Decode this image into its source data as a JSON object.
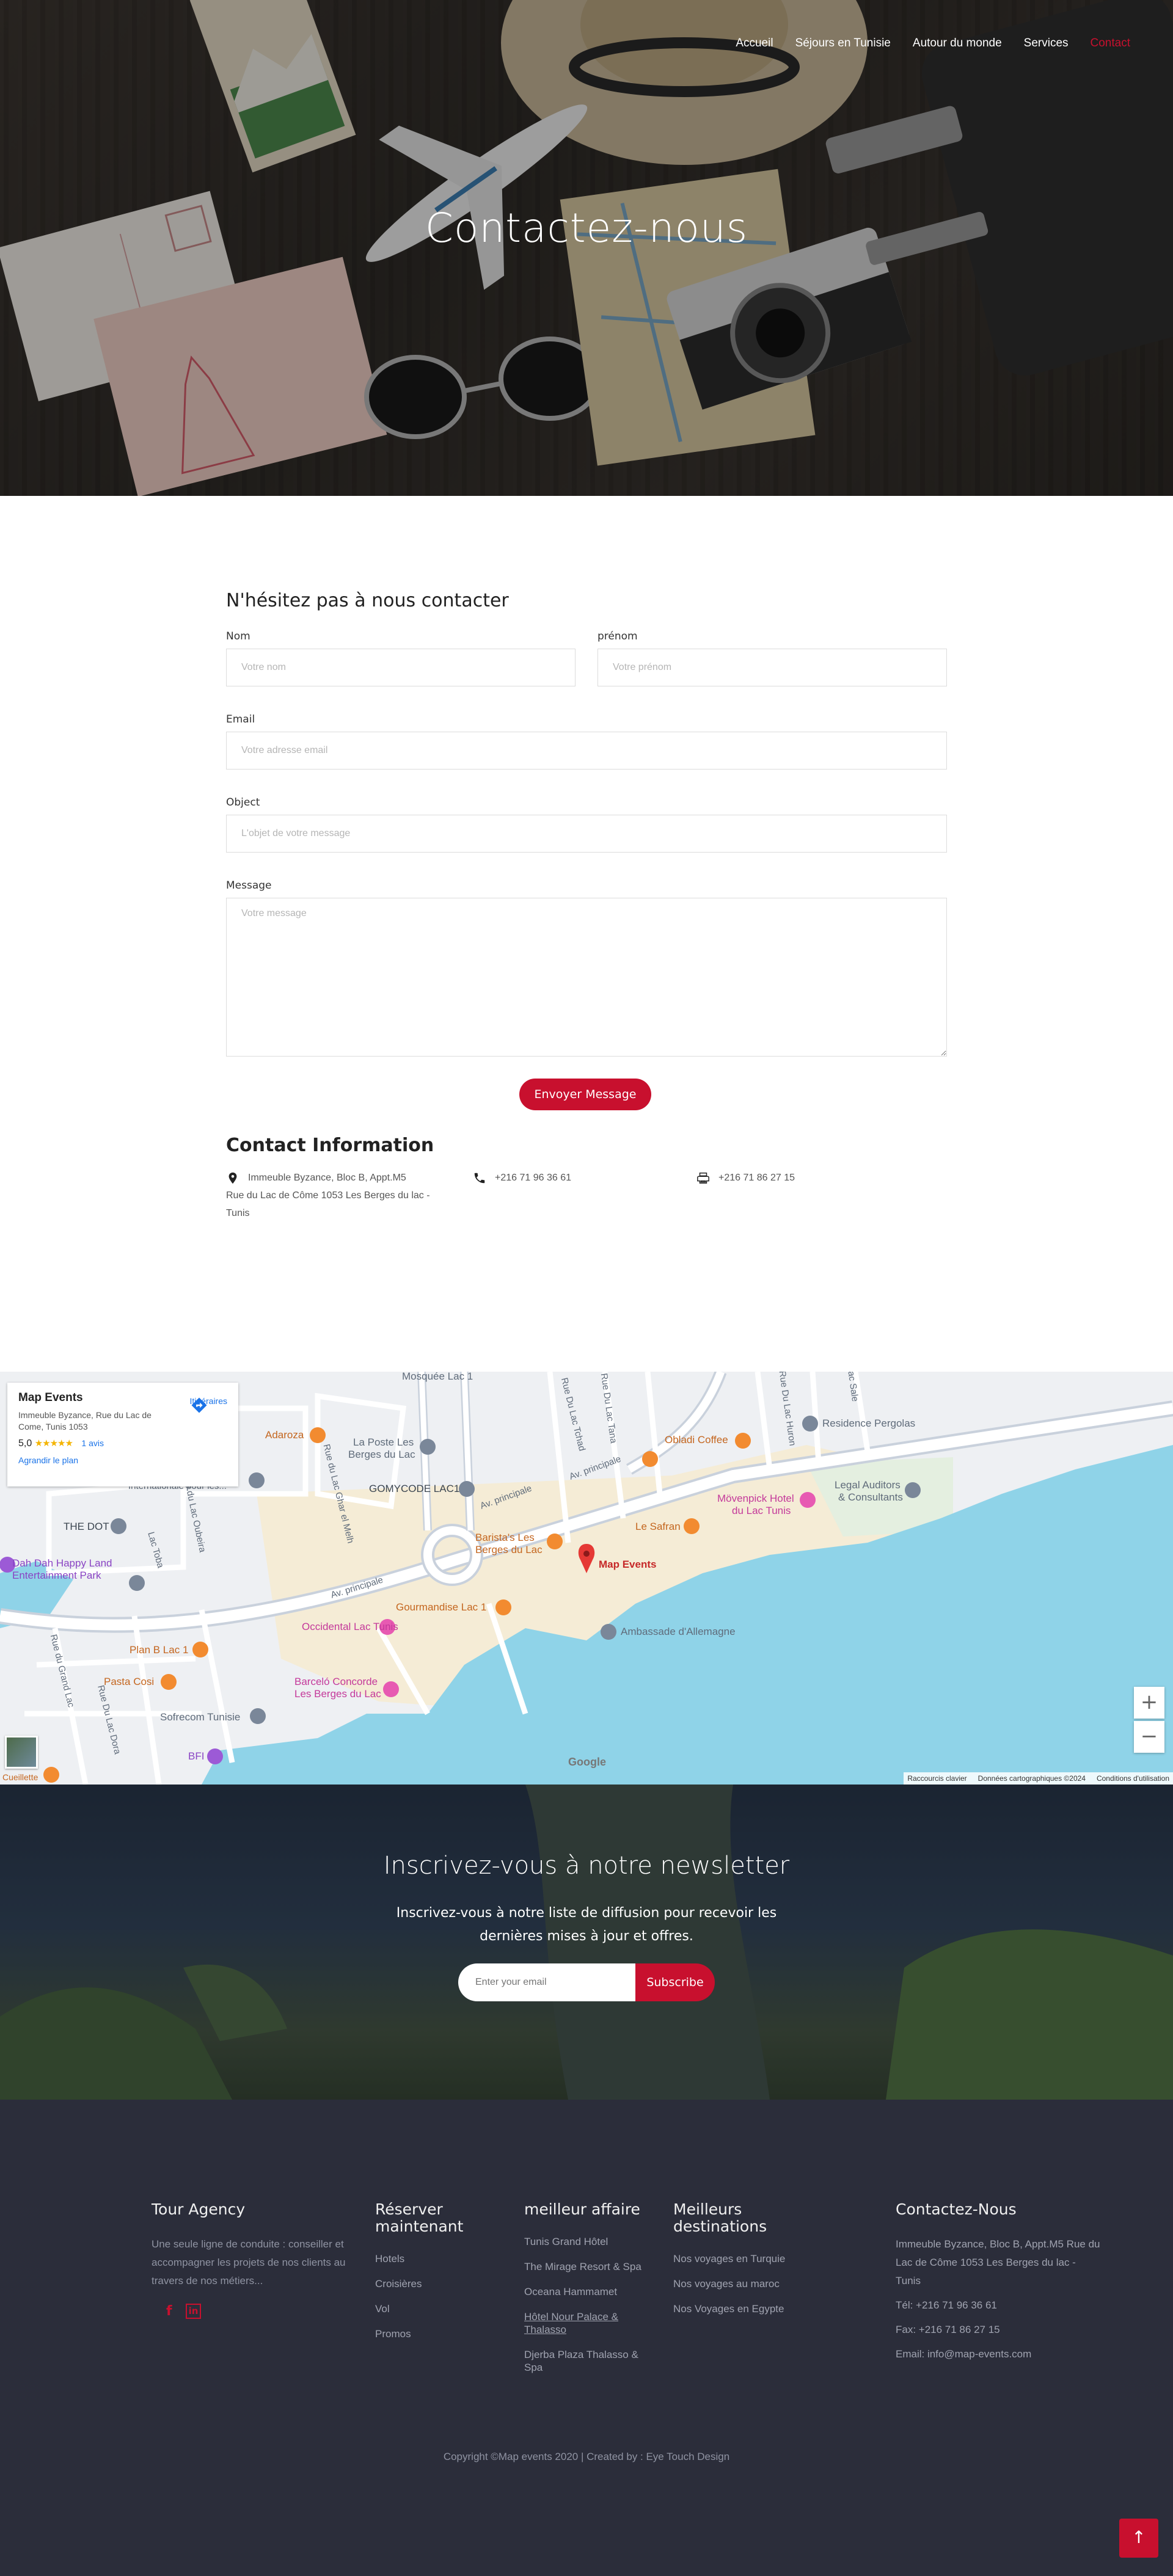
{
  "nav": {
    "items": [
      "Accueil",
      "Séjours en Tunisie",
      "Autour du monde",
      "Services",
      "Contact"
    ],
    "active_index": 4,
    "active_color": "#c8102e"
  },
  "hero": {
    "title": "Contactez-nous"
  },
  "form": {
    "heading": "N'hésitez pas à nous contacter",
    "nom_label": "Nom",
    "nom_placeholder": "Votre nom",
    "prenom_label": "prénom",
    "prenom_placeholder": "Votre prénom",
    "email_label": "Email",
    "email_placeholder": "Votre adresse email",
    "object_label": "Object",
    "object_placeholder": "L'objet de votre message",
    "message_label": "Message",
    "message_placeholder": "Votre message",
    "submit_label": "Envoyer Message"
  },
  "contact_info": {
    "title": "Contact Information",
    "address_line1": "Immeuble Byzance, Bloc B, Appt.M5",
    "address_line2": "Rue du Lac de Côme 1053 Les Berges du lac -",
    "address_line3": "Tunis",
    "phone": "+216 71 96 36 61",
    "fax": "+216 71 86 27 15"
  },
  "map": {
    "card_name": "Map Events",
    "card_address": "Immeuble Byzance, Rue du Lac de Come, Tunis 1053",
    "card_rating": "5,0",
    "card_stars": "★★★★★",
    "card_reviews": "1 avis",
    "card_enlarge": "Agrandir le plan",
    "card_directions": "Itinéraires",
    "marker_label": "Map Events",
    "google": "Google",
    "footer_shortcuts": "Raccourcis clavier",
    "footer_data": "Données cartographiques ©2024",
    "footer_terms": "Conditions d'utilisation",
    "zoom_in": "+",
    "zoom_out": "−",
    "places": {
      "mosquee": "Mosquée Lac 1",
      "adaroza": "Adaroza",
      "la_poste_1": "La Poste Les",
      "la_poste_2": "Berges du Lac",
      "gomycode": "GOMYCODE LAC1",
      "the_dot": "THE DOT",
      "dah_dah_1": "Dah Dah Happy Land",
      "dah_dah_2": "Entertainment Park",
      "plan_b": "Plan B Lac 1",
      "pasta_cosi": "Pasta Cosi",
      "sofrecom": "Sofrecom Tunisie",
      "bfi": "BFI",
      "baristas_1": "Barista's Les",
      "baristas_2": "Berges du Lac",
      "gourmandise": "Gourmandise Lac 1",
      "occidental": "Occidental Lac Tunis",
      "barcelo_1": "Barceló Concorde",
      "barcelo_2": "Les Berges du Lac",
      "ambassade": "Ambassade d'Allemagne",
      "obladi": "Obladi Coffee",
      "residence": "Residence Pergolas",
      "movenpick_1": "Mövenpick Hotel",
      "movenpick_2": "du Lac Tunis",
      "le_safran": "Le Safran",
      "legal_1": "Legal Auditors",
      "legal_2": "& Consultants",
      "av_principale": "Av. principale",
      "rue_lac_tchad": "Rue Du Lac Tchad",
      "rue_lac_toba": "Lac Toba",
      "rue_lac_oubeira": "Rue du Lac Oubeira",
      "rue_lac_ghar": "Rue du Lac Ghar el Melh",
      "rue_grand_lac": "Rue du Grand Lac",
      "rue_lac_dora": "Rue Du Lac Dora",
      "rue_lac_tana": "Rue Du Lac Tana",
      "rue_lac_huron": "Rue Du Lac Huron",
      "rue_lac_sale": "Lac Sale",
      "internationale": "Internationale pour les...",
      "la_cueillette": "Cueillette"
    }
  },
  "newsletter": {
    "title": "Inscrivez-vous à notre newsletter",
    "text": "Inscrivez-vous à notre liste de diffusion pour recevoir les dernières mises à jour et offres.",
    "placeholder": "Enter your email",
    "button": "Subscribe"
  },
  "footer": {
    "about_title": "Tour Agency",
    "about_text": "Une seule ligne de conduite : conseiller et accompagner les projets de nos clients au travers de nos métiers...",
    "social": [
      "f",
      "in"
    ],
    "book_title": "Réserver maintenant",
    "book_links": [
      "Hotels",
      "Croisières",
      "Vol",
      "Promos"
    ],
    "deals_title": "meilleur affaire",
    "deals_links": [
      "Tunis Grand Hôtel",
      "The Mirage Resort & Spa",
      "Oceana Hammamet",
      "Hôtel Nour Palace & Thalasso",
      "Djerba Plaza Thalasso & Spa"
    ],
    "dest_title": "Meilleurs destinations",
    "dest_links": [
      "Nos voyages en Turquie",
      "Nos voyages au maroc",
      "Nos Voyages en Egypte"
    ],
    "contact_title": "Contactez-Nous",
    "contact_address": "Immeuble Byzance, Bloc B, Appt.M5 Rue du Lac de Côme 1053 Les Berges du lac - Tunis",
    "contact_tel": "Tél: +216 71 96 36 61",
    "contact_fax": "Fax: +216 71 86 27 15",
    "contact_email": "Email: info@map-events.com",
    "copyright": "Copyright ©Map events 2020 | Created by : Eye Touch Design",
    "to_top": "↑"
  },
  "colors": {
    "brand_red": "#c8102e",
    "footer_bg": "#2b2d3a"
  }
}
